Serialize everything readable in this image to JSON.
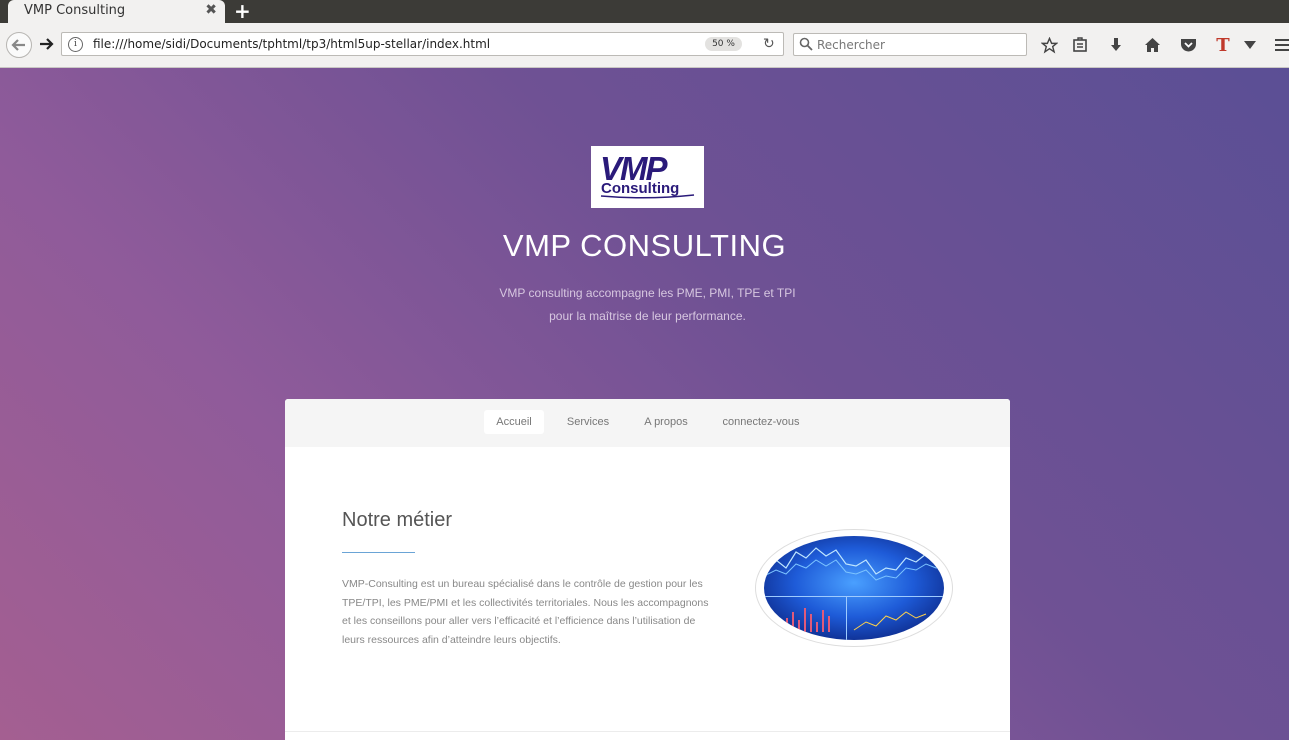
{
  "browser": {
    "tab_title": "VMP Consulting",
    "tab_close": "✖",
    "new_tab": "+",
    "url": "file:///home/sidi/Documents/tphtml/tp3/html5up-stellar/index.html",
    "zoom": "50 %",
    "search_placeholder": "Rechercher",
    "toolbar_T": "T"
  },
  "header": {
    "logo_text_main": "VMP",
    "logo_text_sub": "Consulting",
    "title": "VMP CONSULTING",
    "tagline_line1": "VMP consulting accompagne les PME, PMI, TPE et TPI",
    "tagline_line2": "pour la maîtrise de leur performance."
  },
  "nav": {
    "items": [
      {
        "label": "Accueil",
        "active": true
      },
      {
        "label": "Services",
        "active": false
      },
      {
        "label": "A propos",
        "active": false
      },
      {
        "label": "connectez-vous",
        "active": false
      }
    ]
  },
  "main": {
    "section_title": "Notre métier",
    "section_text": "VMP-Consulting est un bureau spécialisé dans le contrôle de gestion pour les TPE/TPI, les PME/PMI et les collectivités territoriales. Nous les accompagnons et les conseillons pour aller vers l’efficacité et l’efficience dans l’utilisation de leurs ressources afin d’atteindre leurs objectifs."
  }
}
